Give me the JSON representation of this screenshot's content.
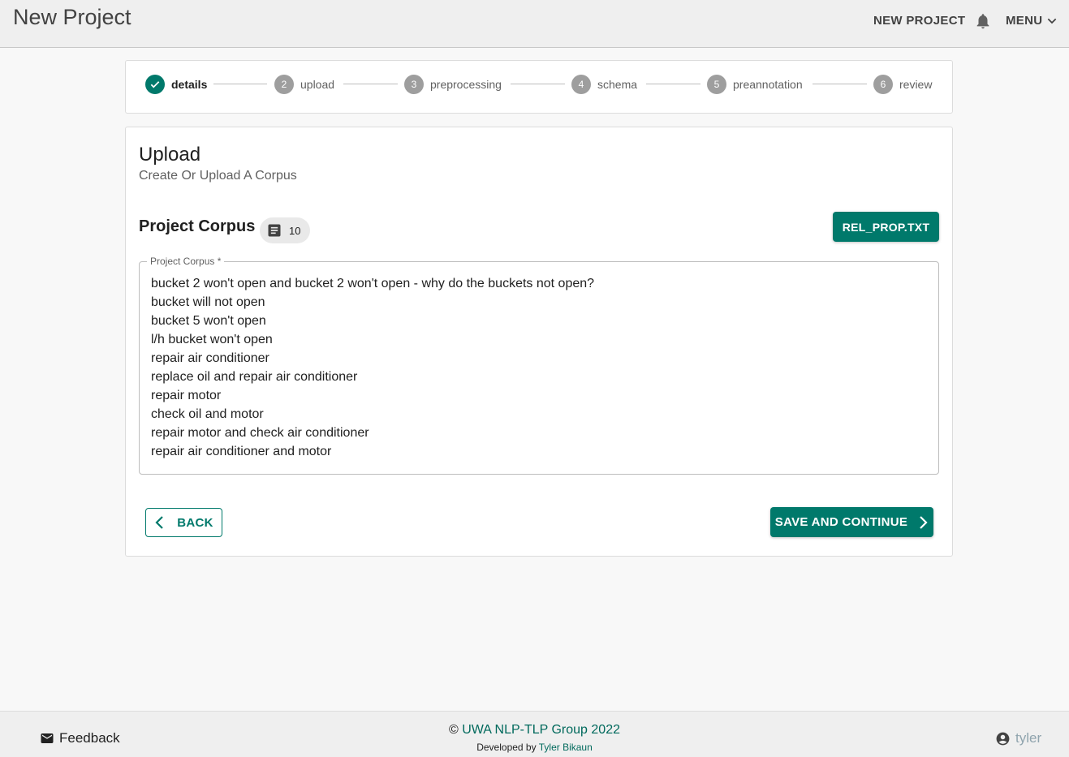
{
  "header": {
    "title": "New Project",
    "new_project_label": "NEW PROJECT",
    "menu_label": "MENU"
  },
  "stepper": {
    "steps": [
      {
        "number": "✓",
        "label": "details",
        "status": "complete"
      },
      {
        "number": "2",
        "label": "upload",
        "status": "pending"
      },
      {
        "number": "3",
        "label": "preprocessing",
        "status": "pending"
      },
      {
        "number": "4",
        "label": "schema",
        "status": "pending"
      },
      {
        "number": "5",
        "label": "preannotation",
        "status": "pending"
      },
      {
        "number": "6",
        "label": "review",
        "status": "pending"
      }
    ]
  },
  "upload": {
    "title": "Upload",
    "subtitle": "Create Or Upload A Corpus",
    "corpus_title": "Project Corpus",
    "doc_count": "10",
    "file_button": "REL_PROP.TXT",
    "field_label": "Project Corpus *",
    "corpus_lines": [
      "bucket 2 won't open and bucket 2 won't open - why do the buckets not open?",
      "bucket will not open",
      "bucket 5 won't open",
      "l/h bucket won't open",
      "repair air conditioner",
      "replace oil and repair air conditioner",
      "repair motor",
      "check oil and motor",
      "repair motor and check air conditioner",
      "repair air conditioner and motor"
    ],
    "back_label": "BACK",
    "save_label": "SAVE AND CONTINUE"
  },
  "footer": {
    "feedback_label": "Feedback",
    "copyright_symbol": "©",
    "copyright_org": "UWA NLP-TLP Group 2022",
    "developed_by": "Developed by",
    "developer": "Tyler Bikaun",
    "username": "tyler"
  },
  "colors": {
    "accent": "#00796b",
    "step_pending": "#9e9e9e",
    "link": "#00695c"
  }
}
